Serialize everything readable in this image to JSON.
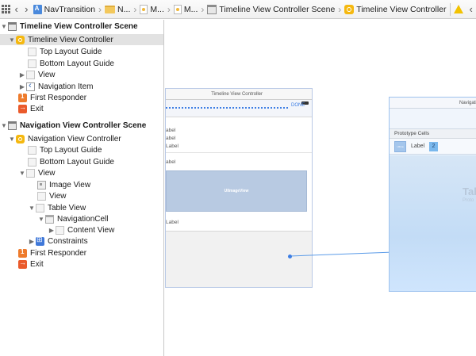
{
  "jumpbar": {
    "grid_icon": "grid-icon",
    "back_icon": "‹",
    "forward_icon": "›",
    "separator": "›",
    "crumbs": [
      {
        "label": "NavTransition",
        "icon": "project-icon"
      },
      {
        "label": "N...",
        "icon": "folder-icon"
      },
      {
        "label": "M...",
        "icon": "file-icon"
      },
      {
        "label": "M...",
        "icon": "file-icon"
      },
      {
        "label": "Timeline View Controller Scene",
        "icon": "scene-icon"
      },
      {
        "label": "Timeline View Controller",
        "icon": "view-controller-icon"
      }
    ],
    "prev_issue": "‹"
  },
  "outline": {
    "expanded_glyph": "▼",
    "collapsed_glyph": "▶",
    "rows": [
      {
        "label": "Timeline View Controller Scene",
        "icon": "scene",
        "bold": true,
        "disclosure": "open"
      },
      {
        "label": "Timeline View Controller",
        "icon": "view-controller",
        "selected": true,
        "disclosure": "open"
      },
      {
        "label": "Top Layout Guide",
        "icon": "box"
      },
      {
        "label": "Bottom Layout Guide",
        "icon": "box"
      },
      {
        "label": "View",
        "icon": "box",
        "disclosure": "closed"
      },
      {
        "label": "Navigation Item",
        "icon": "nav",
        "disclosure": "closed"
      },
      {
        "label": "First Responder",
        "icon": "first-responder"
      },
      {
        "label": "Exit",
        "icon": "exit"
      },
      {
        "label": "Navigation View Controller Scene",
        "icon": "scene",
        "bold": true,
        "disclosure": "open"
      },
      {
        "label": "Navigation View Controller",
        "icon": "view-controller",
        "disclosure": "open"
      },
      {
        "label": "Top Layout Guide",
        "icon": "box"
      },
      {
        "label": "Bottom Layout Guide",
        "icon": "box"
      },
      {
        "label": "View",
        "icon": "box",
        "disclosure": "open"
      },
      {
        "label": "Image View",
        "icon": "image"
      },
      {
        "label": "View",
        "icon": "box"
      },
      {
        "label": "Table View",
        "icon": "box",
        "disclosure": "open"
      },
      {
        "label": "NavigationCell",
        "icon": "cell",
        "disclosure": "open"
      },
      {
        "label": "Content View",
        "icon": "box",
        "disclosure": "closed"
      },
      {
        "label": "Constraints",
        "icon": "constraints",
        "disclosure": "closed"
      },
      {
        "label": "First Responder",
        "icon": "first-responder"
      },
      {
        "label": "Exit",
        "icon": "exit"
      }
    ]
  },
  "canvas": {
    "timeline_scene": {
      "title": "Timeline View Controller",
      "done_label": "DONE",
      "labels": [
        "abel",
        "abel",
        "Label",
        "abel",
        "Label"
      ],
      "image_view_label": "UIImageView"
    },
    "navigation_scene": {
      "title": "Navigati",
      "prototype_header": "Prototype Cells",
      "cell_image_label": "UIIma",
      "cell_label": "Label",
      "cell_badge": "2",
      "table_title": "Tabl",
      "table_subtitle": "Proto"
    },
    "accent_color": "#3d7ee4"
  }
}
